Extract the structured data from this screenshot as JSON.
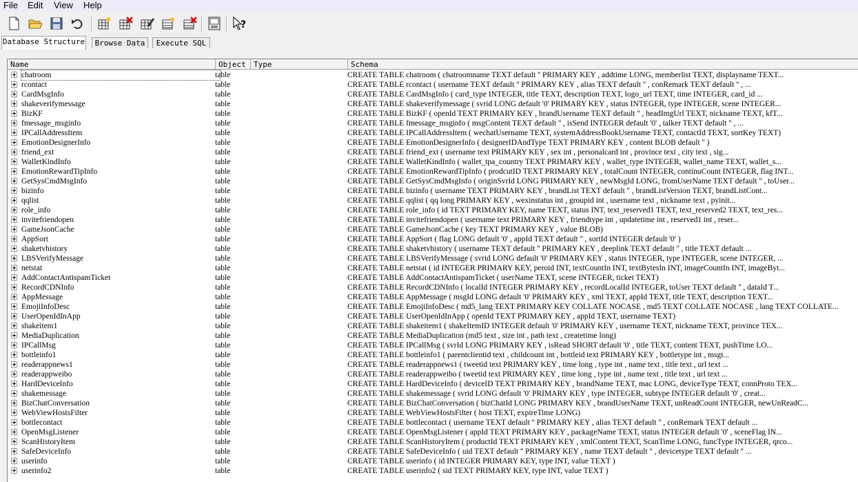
{
  "menu": [
    "File",
    "Edit",
    "View",
    "Help"
  ],
  "toolbar_icons": [
    "new-database-icon",
    "open-database-icon",
    "save-icon",
    "undo-icon",
    "create-table-icon",
    "delete-table-icon",
    "modify-table-icon",
    "create-index-icon",
    "delete-index-icon",
    "execute-log-icon",
    "whats-this-help-icon"
  ],
  "tabs": [
    {
      "label": "Database Structure",
      "active": true
    },
    {
      "label": "Browse Data",
      "active": false
    },
    {
      "label": "Execute SQL",
      "active": false
    }
  ],
  "columns": {
    "name": "Name",
    "object": "Object",
    "type": "Type",
    "schema": "Schema"
  },
  "rows": [
    {
      "name": "chatroom",
      "object": "table",
      "schema": "CREATE TABLE chatroom (  chatroomname TEXT default ''  PRIMARY KEY ,  addtime LONG,  memberlist TEXT,  displayname TEXT..."
    },
    {
      "name": "rcontact",
      "object": "table",
      "schema": "CREATE TABLE rcontact (  username TEXT default ''  PRIMARY KEY ,  alias TEXT default '' ,  conRemark TEXT default '' ,  ..."
    },
    {
      "name": "CardMsgInfo",
      "object": "table",
      "schema": "CREATE TABLE CardMsgInfo (  card_type INTEGER,  title TEXT,  description TEXT,  logo_url TEXT,  time INTEGER,  card_id ..."
    },
    {
      "name": "shakeverifymessage",
      "object": "table",
      "schema": "CREATE TABLE shakeverifymessage (  svrid LONG default '0'  PRIMARY KEY ,  status INTEGER,  type INTEGER,  scene INTEGER..."
    },
    {
      "name": "BizKF",
      "object": "table",
      "schema": "CREATE TABLE BizKF (  openId TEXT PRIMARY KEY ,  brandUsername TEXT default '' ,  headImgUrl TEXT,  nickname TEXT,  kfT..."
    },
    {
      "name": "fmessage_msginfo",
      "object": "table",
      "schema": "CREATE TABLE fmessage_msginfo (  msgContent TEXT default '' ,  isSend INTEGER default '0' ,  talker TEXT default '' ,  ..."
    },
    {
      "name": "IPCallAddressItem",
      "object": "table",
      "schema": "CREATE TABLE IPCallAddressItem (  wechatUsername TEXT,  systemAddressBookUsername TEXT,  contactId TEXT,  sortKey TEXT)"
    },
    {
      "name": "EmotionDesignerInfo",
      "object": "table",
      "schema": "CREATE TABLE EmotionDesignerInfo (  designerIDAndType TEXT PRIMARY KEY ,  content BLOB default '' )"
    },
    {
      "name": "friend_ext",
      "object": "table",
      "schema": "CREATE TABLE friend_ext ( username text  PRIMARY KEY , sex int  , personalcard int  , province text  , city text  , sig..."
    },
    {
      "name": "WalletKindInfo",
      "object": "table",
      "schema": "CREATE TABLE WalletKindInfo (  wallet_tpa_country TEXT PRIMARY KEY ,  wallet_type INTEGER,  wallet_name TEXT,  wallet_s..."
    },
    {
      "name": "EmotionRewardTipInfo",
      "object": "table",
      "schema": "CREATE TABLE EmotionRewardTipInfo (  prodcutID TEXT PRIMARY KEY ,  totalCount INTEGER,  continuCount INTEGER,  flag INT..."
    },
    {
      "name": "GetSysCmdMsgInfo",
      "object": "table",
      "schema": "CREATE TABLE GetSysCmdMsgInfo (  originSvrId LONG PRIMARY KEY ,  newMsgId LONG,  fromUserName TEXT default '' ,  toUser..."
    },
    {
      "name": "bizinfo",
      "object": "table",
      "schema": "CREATE TABLE bizinfo (  username TEXT PRIMARY KEY ,  brandList TEXT default '' ,  brandListVersion TEXT,  brandListCont..."
    },
    {
      "name": "qqlist",
      "object": "table",
      "schema": "CREATE TABLE qqlist ( qq long  PRIMARY KEY , wexinstatus int  , groupid int  , username text  , nickname text  , pyinit..."
    },
    {
      "name": "role_info",
      "object": "table",
      "schema": "CREATE TABLE role_info ( id TEXT PRIMARY KEY, name TEXT, status INT, text_reserved1 TEXT, text_reserved2 TEXT, text_res..."
    },
    {
      "name": "invitefriendopen",
      "object": "table",
      "schema": "CREATE TABLE invitefriendopen ( username text  PRIMARY KEY , friendtype int  , updatetime int  , reserved1 int  , reser..."
    },
    {
      "name": "GameJsonCache",
      "object": "table",
      "schema": "CREATE TABLE GameJsonCache (  key TEXT PRIMARY KEY ,  value BLOB)"
    },
    {
      "name": "AppSort",
      "object": "table",
      "schema": "CREATE TABLE AppSort (  flag LONG default '0' ,  appId TEXT default '' ,  sortId INTEGER default '0' )"
    },
    {
      "name": "shaketvhistory",
      "object": "table",
      "schema": "CREATE TABLE shaketvhistory (  username TEXT default ''  PRIMARY KEY ,  deeplink TEXT default '' ,  title TEXT default ..."
    },
    {
      "name": "LBSVerifyMessage",
      "object": "table",
      "schema": "CREATE TABLE LBSVerifyMessage (  svrid LONG default '0'  PRIMARY KEY ,  status INTEGER,  type INTEGER,  scene INTEGER, ..."
    },
    {
      "name": "netstat",
      "object": "table",
      "schema": "CREATE TABLE netstat ( id INTEGER PRIMARY KEY, peroid INT, textCountIn INT, textBytesIn INT, imageCountIn INT, imageByt..."
    },
    {
      "name": "AddContactAntispamTicket",
      "object": "table",
      "schema": "CREATE TABLE AddContactAntispamTicket (  userName TEXT,  scene INTEGER,  ticket TEXT)"
    },
    {
      "name": "RecordCDNInfo",
      "object": "table",
      "schema": "CREATE TABLE RecordCDNInfo (  localId INTEGER PRIMARY KEY ,  recordLocalId INTEGER,  toUser TEXT default '' ,  dataId T..."
    },
    {
      "name": "AppMessage",
      "object": "table",
      "schema": "CREATE TABLE AppMessage (  msgId LONG default '0'  PRIMARY KEY ,  xml TEXT,  appId TEXT,  title TEXT,  description TEXT..."
    },
    {
      "name": "EmojiInfoDesc",
      "object": "table",
      "schema": "CREATE TABLE EmojiInfoDesc (  md5_lang TEXT PRIMARY KEY  COLLATE NOCASE ,  md5 TEXT COLLATE NOCASE ,  lang TEXT COLLATE..."
    },
    {
      "name": "UserOpenIdInApp",
      "object": "table",
      "schema": "CREATE TABLE UserOpenIdInApp (  openId TEXT PRIMARY KEY ,  appId TEXT,  username TEXT)"
    },
    {
      "name": "shakeitem1",
      "object": "table",
      "schema": "CREATE TABLE shakeitem1 (  shakeItemID INTEGER default '0'  PRIMARY KEY ,  username TEXT,  nickname TEXT,  province TEX..."
    },
    {
      "name": "MediaDuplication",
      "object": "table",
      "schema": "CREATE TABLE MediaDuplication (md5 text , size int , path text , createtime long)"
    },
    {
      "name": "IPCallMsg",
      "object": "table",
      "schema": "CREATE TABLE IPCallMsg (  svrId LONG PRIMARY KEY ,  isRead SHORT default '0' ,  title TEXT,  content TEXT,  pushTime LO..."
    },
    {
      "name": "bottleinfo1",
      "object": "table",
      "schema": "CREATE TABLE bottleinfo1 ( parentclientid text  , childcount int  , bottleid text  PRIMARY KEY , bottletype int  , msgt..."
    },
    {
      "name": "readerappnews1",
      "object": "table",
      "schema": "CREATE TABLE readerappnews1 ( tweetid text  PRIMARY KEY , time long  , type int  , name text  , title text  , url text ..."
    },
    {
      "name": "readerappweibo",
      "object": "table",
      "schema": "CREATE TABLE readerappweibo ( tweetid text  PRIMARY KEY , time long  , type int  , name text  , title text  , url text ..."
    },
    {
      "name": "HardDeviceInfo",
      "object": "table",
      "schema": "CREATE TABLE HardDeviceInfo (  deviceID TEXT PRIMARY KEY ,  brandName TEXT,  mac LONG,  deviceType TEXT,  connProto TEX..."
    },
    {
      "name": "shakemessage",
      "object": "table",
      "schema": "CREATE TABLE shakemessage (  svrid LONG default '0'  PRIMARY KEY ,  type INTEGER,  subtype INTEGER default '0' ,  creat..."
    },
    {
      "name": "BizChatConversation",
      "object": "table",
      "schema": "CREATE TABLE BizChatConversation (  bizChatId LONG PRIMARY KEY ,  brandUserName TEXT,  unReadCount INTEGER,  newUnReadC..."
    },
    {
      "name": "WebViewHostsFilter",
      "object": "table",
      "schema": "CREATE TABLE WebViewHostsFilter (  host TEXT,  expireTime LONG)"
    },
    {
      "name": "bottlecontact",
      "object": "table",
      "schema": "CREATE TABLE bottlecontact (  username TEXT default ''  PRIMARY KEY ,  alias TEXT default '' ,  conRemark TEXT default ..."
    },
    {
      "name": "OpenMsgListener",
      "object": "table",
      "schema": "CREATE TABLE OpenMsgListener (  appId TEXT PRIMARY KEY ,  packageName TEXT,  status INTEGER default '0' ,  sceneFlag IN..."
    },
    {
      "name": "ScanHistoryItem",
      "object": "table",
      "schema": "CREATE TABLE ScanHistoryItem (  productId TEXT PRIMARY KEY ,  xmlContent TEXT,  ScanTime LONG,  funcType INTEGER,  qrco..."
    },
    {
      "name": "SafeDeviceInfo",
      "object": "table",
      "schema": "CREATE TABLE SafeDeviceInfo (  uid TEXT default ''  PRIMARY KEY ,  name TEXT default '' ,  devicetype TEXT default '' ..."
    },
    {
      "name": "userinfo",
      "object": "table",
      "schema": "CREATE TABLE userinfo ( id INTEGER PRIMARY KEY, type INT, value TEXT )"
    },
    {
      "name": "userinfo2",
      "object": "table",
      "schema": "CREATE TABLE userinfo2 ( sid TEXT PRIMARY KEY, type INT, value TEXT )"
    }
  ]
}
